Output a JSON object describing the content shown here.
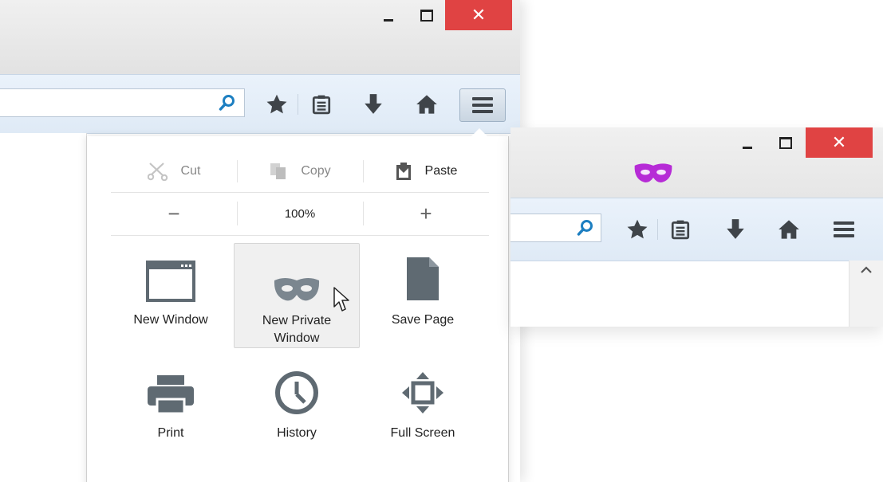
{
  "main_window": {
    "close_symbol": "✕",
    "panel": {
      "clipboard": {
        "cut": "Cut",
        "copy": "Copy",
        "paste": "Paste"
      },
      "zoom": {
        "decrease": "−",
        "level": "100%",
        "increase": "+"
      },
      "items": [
        {
          "label": "New Window",
          "icon": "new-window-icon"
        },
        {
          "label": "New Private Window",
          "icon": "private-mask-icon"
        },
        {
          "label": "Save Page",
          "icon": "save-page-icon"
        },
        {
          "label": "Print",
          "icon": "print-icon"
        },
        {
          "label": "History",
          "icon": "history-icon"
        },
        {
          "label": "Full Screen",
          "icon": "fullscreen-icon"
        }
      ]
    }
  },
  "private_window": {
    "close_symbol": "✕",
    "private_indicator_color": "#b62bd6"
  },
  "colors": {
    "close_button": "#e04343",
    "icon_gray": "#5f6a72",
    "search_blue": "#1d7fc1",
    "toolbar_blue": "#e4eef8"
  }
}
